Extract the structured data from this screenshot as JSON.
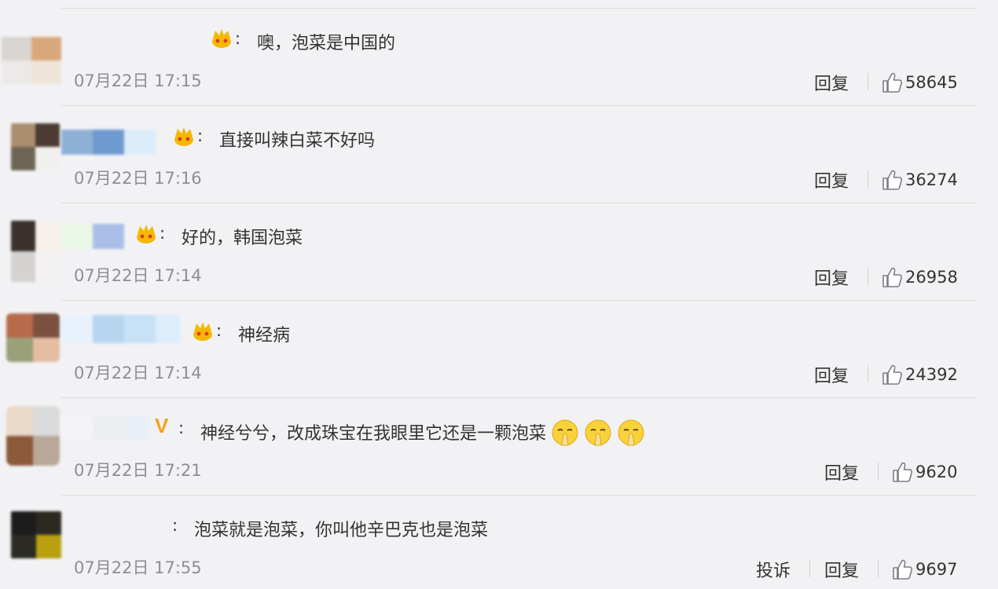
{
  "ui": {
    "colon": ":",
    "reply_label": "回复",
    "report_label": "投诉"
  },
  "comments": [
    {
      "text": "噢，泡菜是中国的",
      "time": "07月22日 17:15",
      "likes": "58645"
    },
    {
      "text": "直接叫辣白菜不好吗",
      "time": "07月22日 17:16",
      "likes": "36274"
    },
    {
      "text": "好的，韩国泡菜",
      "time": "07月22日 17:14",
      "likes": "26958"
    },
    {
      "text": "神经病",
      "time": "07月22日 17:14",
      "likes": "24392"
    },
    {
      "text": "神经兮兮，改成珠宝在我眼里它还是一颗泡菜",
      "time": "07月22日 17:21",
      "likes": "9620",
      "badge": "V"
    },
    {
      "text": "泡菜就是泡菜，你叫他辛巴克也是泡菜",
      "time": "07月22日 17:55",
      "likes": "9697"
    }
  ],
  "colors": {
    "background": "#f2f2f5",
    "text": "#333333",
    "timestamp": "#8d8d94",
    "divider": "#dcdcdc",
    "crown": "#f5b800",
    "verified_badge": "#f6a21a"
  },
  "icons": {
    "crown": "crown-icon",
    "like": "thumbs-up-icon",
    "emoji": "shush-face-emoji"
  }
}
